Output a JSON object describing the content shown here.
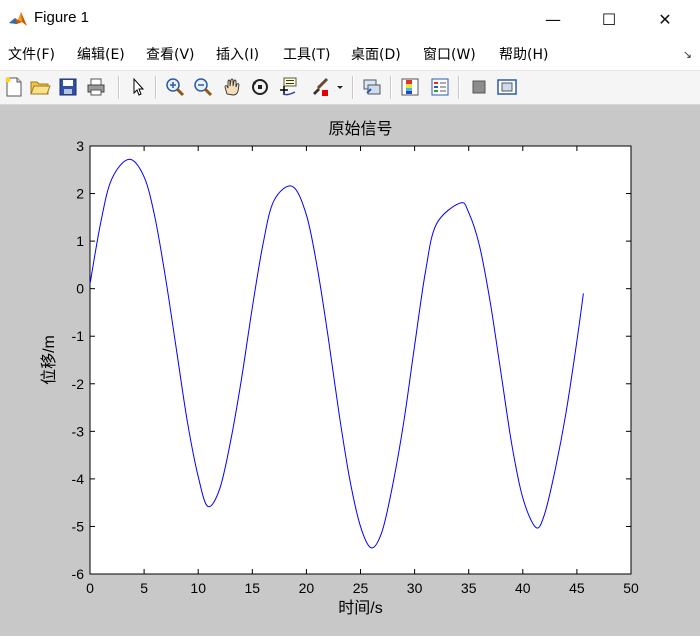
{
  "window": {
    "title": "Figure 1",
    "minimize_glyph": "—",
    "maximize_glyph": "☐",
    "close_glyph": "✕"
  },
  "menubar": {
    "items": [
      {
        "label": "文件(F)"
      },
      {
        "label": "编辑(E)"
      },
      {
        "label": "查看(V)"
      },
      {
        "label": "插入(I)"
      },
      {
        "label": "工具(T)"
      },
      {
        "label": "桌面(D)"
      },
      {
        "label": "窗口(W)"
      },
      {
        "label": "帮助(H)"
      }
    ],
    "overflow_glyph": "↘"
  },
  "toolbar": {
    "icons": [
      "new-file-icon",
      "open-folder-icon",
      "save-icon",
      "print-icon",
      "select-arrow-icon",
      "zoom-in-icon",
      "zoom-out-icon",
      "pan-hand-icon",
      "rotate-3d-icon",
      "data-cursor-icon",
      "brush-icon",
      "link-plot-icon",
      "colorbar-icon",
      "legend-icon",
      "hide-plot-tools-icon",
      "show-plot-tools-icon"
    ]
  },
  "colors": {
    "figure_bg": "#c8c8c8",
    "axes_bg": "#ffffff",
    "line": "#0000ff"
  },
  "chart_data": {
    "type": "line",
    "title": "原始信号",
    "xlabel": "时间/s",
    "ylabel": "位移/m",
    "xlim": [
      0,
      50
    ],
    "ylim": [
      -6,
      3
    ],
    "xticks": [
      "0",
      "5",
      "10",
      "15",
      "20",
      "25",
      "30",
      "35",
      "40",
      "45",
      "50"
    ],
    "yticks": [
      "3",
      "2",
      "1",
      "0",
      "-1",
      "-2",
      "-3",
      "-4",
      "-5",
      "-6"
    ],
    "grid": false,
    "series": [
      {
        "color": "#0000ff",
        "x": [
          0,
          1,
          2,
          3.6,
          5,
          6,
          7,
          8,
          9,
          10,
          10.9,
          12,
          13,
          14,
          15,
          16,
          17,
          18.7,
          20,
          21,
          22,
          23,
          24,
          25,
          26,
          27,
          28,
          29,
          30,
          31,
          32,
          34.2,
          35,
          36,
          37,
          38,
          39,
          40,
          41.2,
          42,
          43,
          44,
          45,
          45.6
        ],
        "y": [
          0.1,
          1.4,
          2.3,
          2.72,
          2.35,
          1.5,
          0.2,
          -1.3,
          -2.8,
          -3.95,
          -4.58,
          -4.2,
          -3.2,
          -1.9,
          -0.4,
          0.95,
          1.85,
          2.15,
          1.55,
          0.45,
          -1.0,
          -2.6,
          -4.0,
          -5.0,
          -5.45,
          -5.1,
          -4.1,
          -2.8,
          -1.2,
          0.35,
          1.35,
          1.8,
          1.6,
          0.9,
          -0.3,
          -1.8,
          -3.3,
          -4.4,
          -5.02,
          -4.75,
          -3.8,
          -2.6,
          -1.1,
          -0.1
        ]
      }
    ]
  }
}
